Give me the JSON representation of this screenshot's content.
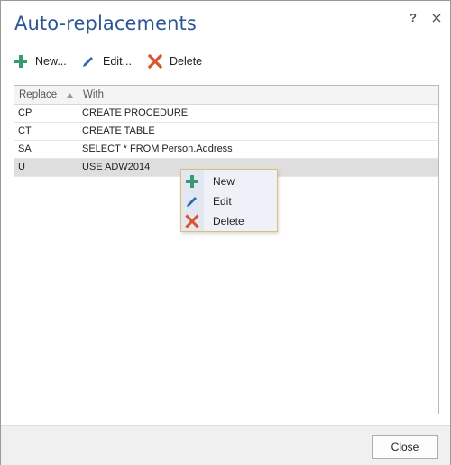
{
  "dialog": {
    "title": "Auto-replacements",
    "help_label": "?"
  },
  "toolbar": {
    "new_label": "New...",
    "edit_label": "Edit...",
    "delete_label": "Delete"
  },
  "grid": {
    "columns": [
      "Replace",
      "With"
    ],
    "sort_column": "Replace",
    "sort_direction": "ascending",
    "rows": [
      {
        "replace": "CP",
        "with": "CREATE PROCEDURE"
      },
      {
        "replace": "CT",
        "with": "CREATE TABLE"
      },
      {
        "replace": "SA",
        "with": "SELECT * FROM Person.Address"
      },
      {
        "replace": "U",
        "with": "USE ADW2014"
      }
    ],
    "selected_row": 3
  },
  "context_menu": {
    "items": [
      {
        "label": "New",
        "icon": "plus-icon"
      },
      {
        "label": "Edit",
        "icon": "pencil-icon"
      },
      {
        "label": "Delete",
        "icon": "delete-x-icon"
      }
    ]
  },
  "footer": {
    "close_label": "Close"
  },
  "colors": {
    "title": "#2b5797",
    "plus": "#3a9a6f",
    "pencil": "#2b6cb5",
    "delete": "#d9532c",
    "selection": "#dedede",
    "menu_border": "#e0c070"
  }
}
